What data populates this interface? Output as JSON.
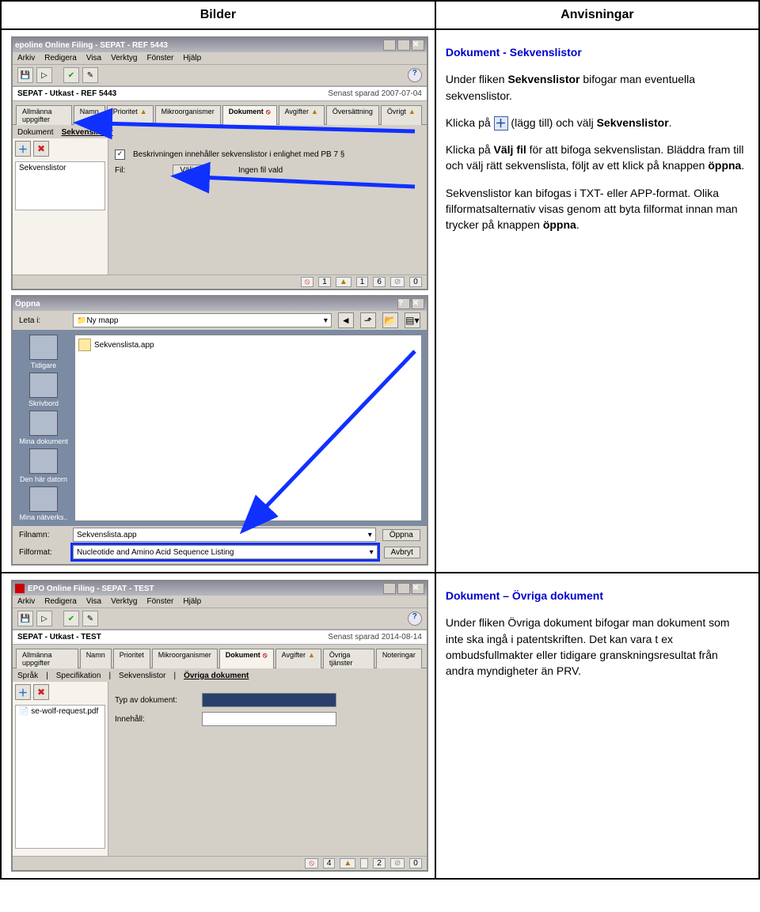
{
  "header": {
    "left": "Bilder",
    "right": "Anvisningar"
  },
  "app1": {
    "title": "epoline Online Filing - SEPAT - REF 5443",
    "menu": [
      "Arkiv",
      "Redigera",
      "Visa",
      "Verktyg",
      "Fönster",
      "Hjälp"
    ],
    "draft_label": "SEPAT - Utkast - REF 5443",
    "saved": "Senast sparad 2007-07-04",
    "tabs": [
      "Allmänna uppgifter",
      "Namn",
      "Prioritet",
      "Mikroorganismer",
      "Dokument",
      "Avgifter",
      "Översättning",
      "Övrigt"
    ],
    "active_tab": "Dokument",
    "subtabs": [
      "Dokument",
      "Sekvenslistor"
    ],
    "list_item": "Sekvenslistor",
    "cb_label": "Beskrivningen innehåller sekvenslistor i enlighet med PB 7 §",
    "fil_label": "Fil:",
    "btn_valj": "Välj fil",
    "no_file": "Ingen fil vald",
    "status": [
      "1",
      "1",
      "6",
      "0"
    ]
  },
  "dlg": {
    "title": "Öppna",
    "leta": "Leta i:",
    "folder": "Ny mapp",
    "file": "Sekvenslista.app",
    "places": [
      "Tidigare",
      "Skrivbord",
      "Mina dokument",
      "Den här datorn",
      "Mina nätverks.."
    ],
    "filnamn_l": "Filnamn:",
    "filnamn_v": "Sekvenslista.app",
    "filformat_l": "Filformat:",
    "filformat_v": "Nucleotide and Amino Acid Sequence Listing",
    "open": "Öppna",
    "cancel": "Avbryt"
  },
  "instr1": {
    "h": "Dokument - Sekvenslistor",
    "p1a": "Under fliken ",
    "p1b": "Sekvenslistor",
    "p1c": " bifogar man eventuella sekvenslistor.",
    "p2a": "Klicka på ",
    "p2b": " (lägg till) och välj ",
    "p2c": "Sekvenslistor",
    "p2d": ".",
    "p3a": "Klicka på ",
    "p3b": "Välj fil",
    "p3c": " för att bifoga sekvenslistan. Bläddra fram till och välj rätt sekvenslista, följt av ett klick på knappen ",
    "p3d": "öppna",
    "p3e": ".",
    "p4a": "Sekvenslistor kan bifogas i TXT- eller APP-format. Olika filformatsalternativ visas genom att byta filformat innan man trycker på knappen ",
    "p4b": "öppna",
    "p4c": "."
  },
  "app2": {
    "title": "EPO Online Filing - SEPAT - TEST",
    "menu": [
      "Arkiv",
      "Redigera",
      "Visa",
      "Verktyg",
      "Fönster",
      "Hjälp"
    ],
    "draft_label": "SEPAT - Utkast - TEST",
    "saved": "Senast sparad 2014-08-14",
    "tabs": [
      "Allmänna uppgifter",
      "Namn",
      "Prioritet",
      "Mikroorganismer",
      "Dokument",
      "Avgifter",
      "Övriga tjänster",
      "Noteringar"
    ],
    "active_tab": "Dokument",
    "subtabs": [
      "Språk",
      "Specifikation",
      "Sekvenslistor",
      "Övriga dokument"
    ],
    "list_item": "se-wolf-request.pdf",
    "typ_l": "Typ av dokument:",
    "innehall_l": "Innehåll:",
    "status": [
      "4",
      "",
      "2",
      "0"
    ]
  },
  "instr2": {
    "h": "Dokument – Övriga dokument",
    "p1": "Under fliken Övriga dokument bifogar man dokument som inte ska ingå i patentskriften. Det kan vara t ex ombudsfullmakter eller tidigare granskningsresultat från andra myndigheter än PRV."
  }
}
